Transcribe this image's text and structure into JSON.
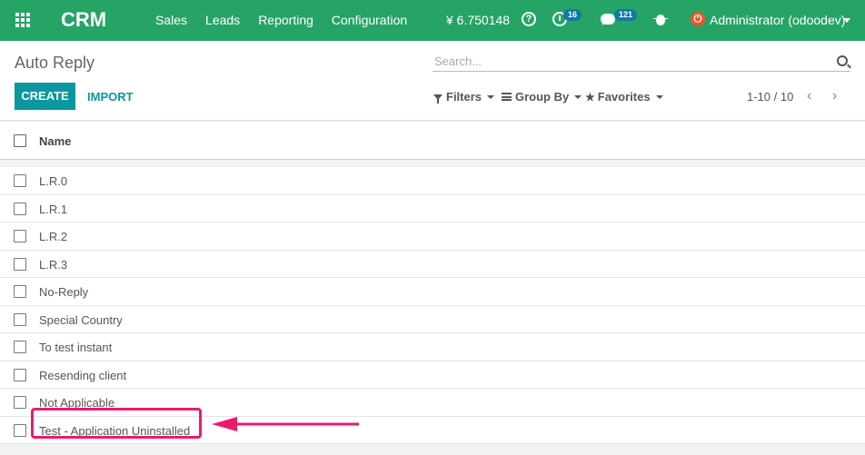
{
  "navbar": {
    "app_name": "CRM",
    "menu": [
      "Sales",
      "Leads",
      "Reporting",
      "Configuration"
    ],
    "balance": "¥ 6.750148",
    "activity_count": "16",
    "message_count": "121",
    "user": "Administrator (odoodev)",
    "accent_color": "#26a466"
  },
  "control_panel": {
    "title": "Auto Reply",
    "search_placeholder": "Search...",
    "create_label": "CREATE",
    "import_label": "IMPORT",
    "filters_label": "Filters",
    "groupby_label": "Group By",
    "favorites_label": "Favorites",
    "pager": "1-10 / 10"
  },
  "list": {
    "column_name": "Name",
    "rows": [
      "L.R.0",
      "L.R.1",
      "L.R.2",
      "L.R.3",
      "No-Reply",
      "Special Country",
      "To test instant",
      "Resending client",
      "Not Applicable",
      "Test - Application Uninstalled"
    ]
  },
  "annotation": {
    "color": "#ea1b6d"
  }
}
